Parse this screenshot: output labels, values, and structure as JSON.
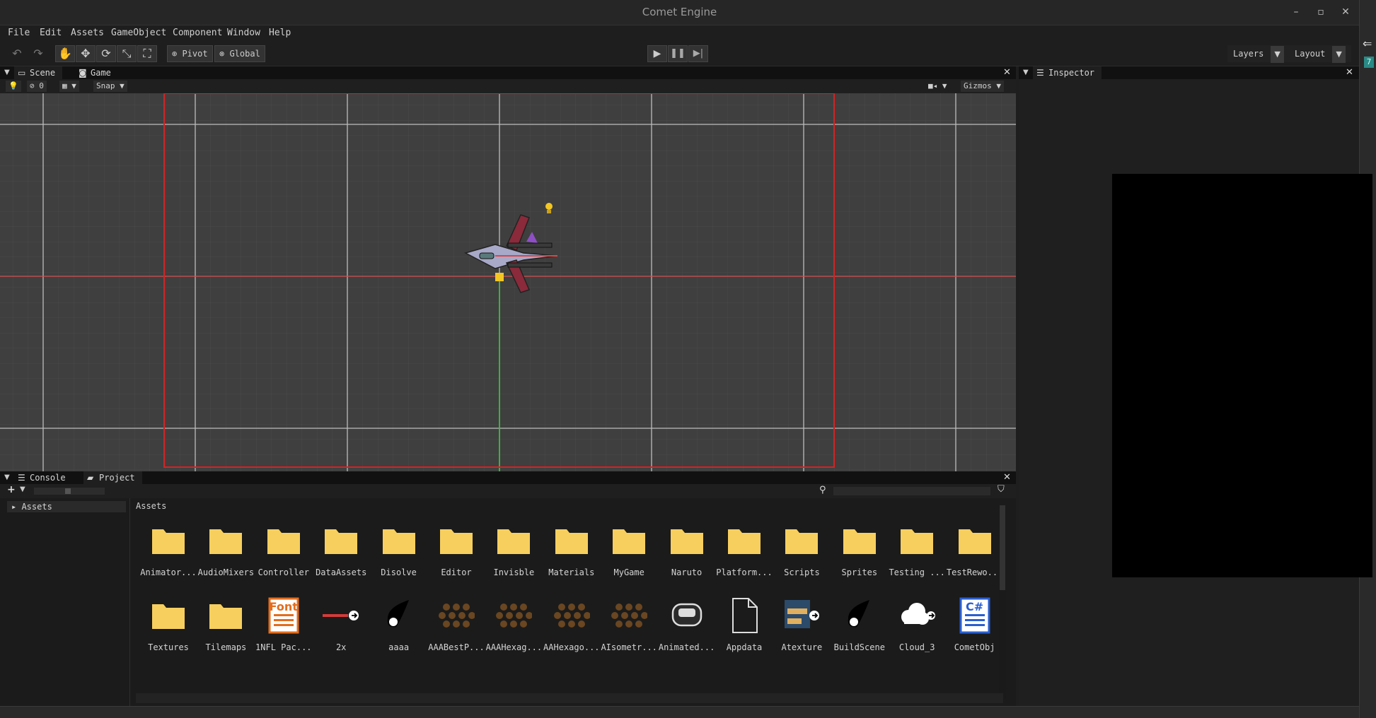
{
  "window": {
    "title": "Comet Engine",
    "min": "–",
    "max": "▫",
    "close": "✕"
  },
  "menu": [
    "File",
    "Edit",
    "Assets",
    "GameObject",
    "Component",
    "Window",
    "Help"
  ],
  "toolbar": {
    "pivot": "Pivot",
    "global": "Global",
    "layers": "Layers",
    "layout": "Layout"
  },
  "scene": {
    "tabs": [
      "Scene",
      "Game"
    ],
    "hidden_count": "0",
    "snap": "Snap",
    "gizmos": "Gizmos"
  },
  "inspector": {
    "title": "Inspector"
  },
  "bottom": {
    "tabs": [
      "Console",
      "Project"
    ],
    "tree_root": "Assets",
    "breadcrumb": "Assets",
    "assets": [
      {
        "name": "Animator...",
        "type": "folder"
      },
      {
        "name": "AudioMixers",
        "type": "folder"
      },
      {
        "name": "Controller",
        "type": "folder"
      },
      {
        "name": "DataAssets",
        "type": "folder"
      },
      {
        "name": "Disolve",
        "type": "folder"
      },
      {
        "name": "Editor",
        "type": "folder"
      },
      {
        "name": "Invisble",
        "type": "folder"
      },
      {
        "name": "Materials",
        "type": "folder"
      },
      {
        "name": "MyGame",
        "type": "folder"
      },
      {
        "name": "Naruto",
        "type": "folder"
      },
      {
        "name": "Platform...",
        "type": "folder"
      },
      {
        "name": "Scripts",
        "type": "folder"
      },
      {
        "name": "Sprites",
        "type": "folder"
      },
      {
        "name": "Testing ...",
        "type": "folder"
      },
      {
        "name": "TestRewo...",
        "type": "folder"
      },
      {
        "name": "Textures",
        "type": "folder"
      },
      {
        "name": "Tilemaps",
        "type": "folder"
      },
      {
        "name": "1NFL Pac...",
        "type": "font",
        "icon_text": "Font"
      },
      {
        "name": "2x",
        "type": "strip"
      },
      {
        "name": "aaaa",
        "type": "comet"
      },
      {
        "name": "AAABestP...",
        "type": "hex"
      },
      {
        "name": "AAAHexag...",
        "type": "hex"
      },
      {
        "name": "AAHexago...",
        "type": "hex"
      },
      {
        "name": "AIsometr...",
        "type": "hex"
      },
      {
        "name": "Animated...",
        "type": "anim"
      },
      {
        "name": "Appdata",
        "type": "file"
      },
      {
        "name": "Atexture",
        "type": "atlas"
      },
      {
        "name": "BuildScene",
        "type": "comet"
      },
      {
        "name": "Cloud_3",
        "type": "cloud"
      },
      {
        "name": "CometObj",
        "type": "csharp",
        "icon_text": "C#"
      }
    ]
  },
  "colors": {
    "folder": "#f7cf5e",
    "accent": "#2a8a86",
    "grid_red": "#d42323",
    "axis_green": "#2fc62f"
  }
}
